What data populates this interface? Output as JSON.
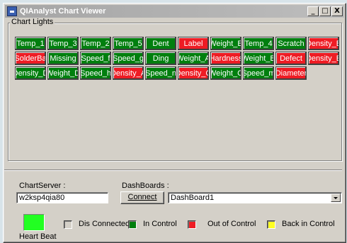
{
  "window": {
    "title": "QIAnalyst Chart Viewer",
    "controls": {
      "minimize": "_",
      "maximize": "□",
      "close": "X"
    }
  },
  "chart_lights": {
    "label": "Chart Lights",
    "items": [
      {
        "label": "Temp_1",
        "status": "green"
      },
      {
        "label": "Temp_3",
        "status": "green"
      },
      {
        "label": "Temp_2",
        "status": "green"
      },
      {
        "label": "Temp_5",
        "status": "green"
      },
      {
        "label": "Dent",
        "status": "green"
      },
      {
        "label": "Label",
        "status": "red"
      },
      {
        "label": "Weight_E",
        "status": "green"
      },
      {
        "label": "Temp_4",
        "status": "green"
      },
      {
        "label": "Scratch",
        "status": "green"
      },
      {
        "label": "Density_B",
        "status": "red"
      },
      {
        "label": "SolderBa",
        "status": "red"
      },
      {
        "label": "Missing",
        "status": "green"
      },
      {
        "label": "Speed_f",
        "status": "green"
      },
      {
        "label": "Speed_g",
        "status": "green"
      },
      {
        "label": "Ding",
        "status": "green"
      },
      {
        "label": "Weight_A",
        "status": "green"
      },
      {
        "label": "Hardness",
        "status": "red"
      },
      {
        "label": "Weight_B",
        "status": "green"
      },
      {
        "label": "Defect",
        "status": "red"
      },
      {
        "label": "Density_E",
        "status": "red"
      },
      {
        "label": "Density_D",
        "status": "green"
      },
      {
        "label": "Weight_D",
        "status": "green"
      },
      {
        "label": "Speed_h",
        "status": "green"
      },
      {
        "label": "Density_A",
        "status": "red"
      },
      {
        "label": "Speed_n",
        "status": "green"
      },
      {
        "label": "Density_C",
        "status": "red"
      },
      {
        "label": "Weight_C",
        "status": "green"
      },
      {
        "label": "Speed_m",
        "status": "green"
      },
      {
        "label": "Diameter",
        "status": "red"
      }
    ]
  },
  "chart_server": {
    "label": "ChartServer :",
    "value": "w2ksp4qia80"
  },
  "dashboards": {
    "label": "DashBoards :",
    "connect_label": "Connect",
    "selected": "DashBoard1"
  },
  "legend": {
    "heartbeat_label": "Heart Beat",
    "items": [
      {
        "label": "Dis Connected",
        "color": "#d4d0c8"
      },
      {
        "label": "In Control",
        "color": "#007f0e"
      },
      {
        "label": "Out of Control",
        "color": "#ee1c24"
      },
      {
        "label": "Back in Control",
        "color": "#ffff22"
      }
    ]
  },
  "colors": {
    "green": "#007f0e",
    "red": "#ee1c24",
    "heartbeat": "#22ff22"
  }
}
